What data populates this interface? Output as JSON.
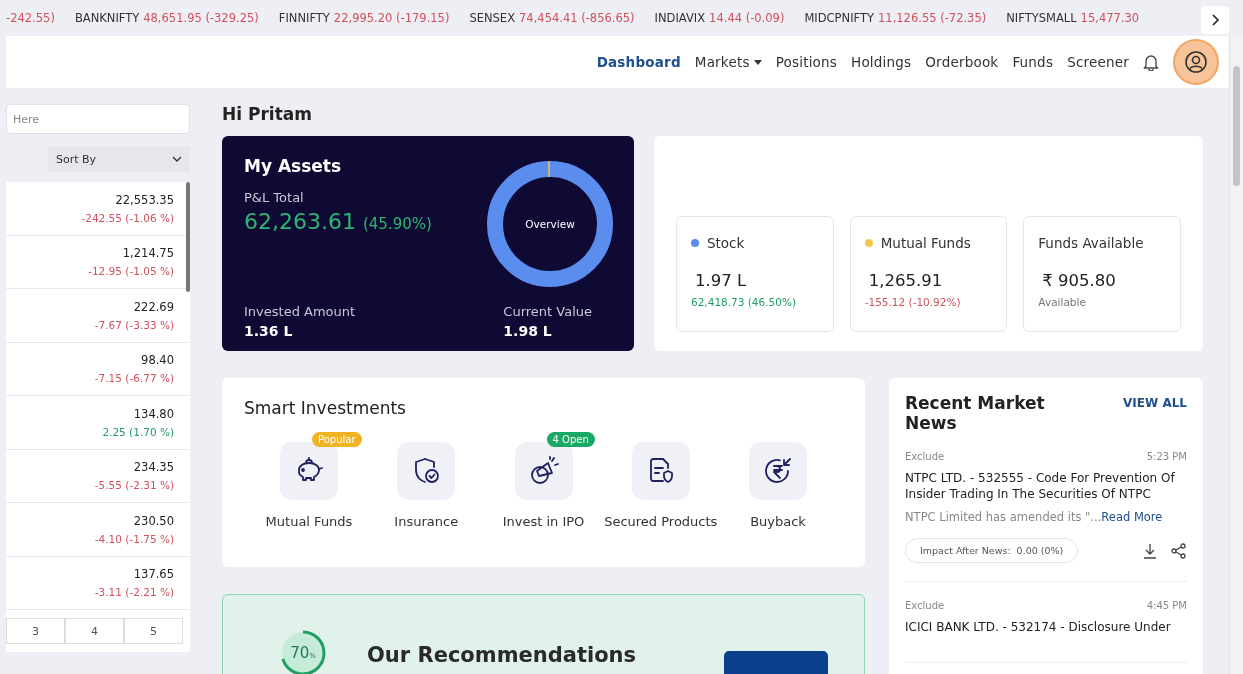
{
  "ticker": [
    {
      "change": "-242.55)",
      "kind": "loss"
    },
    {
      "name": "BANKNIFTY",
      "value": "48,651.95 (-329.25)",
      "kind": "loss"
    },
    {
      "name": "FINNIFTY",
      "value": "22,995.20 (-179.15)",
      "kind": "loss"
    },
    {
      "name": "SENSEX",
      "value": "74,454.41 (-856.65)",
      "kind": "loss"
    },
    {
      "name": "INDIAVIX",
      "value": "14.44 (-0.09)",
      "kind": "loss"
    },
    {
      "name": "MIDCPNIFTY",
      "value": "11,126.55 (-72.35)",
      "kind": "loss"
    },
    {
      "name": "NIFTYSMALL",
      "value": "15,477.30",
      "kind": "loss"
    }
  ],
  "nav": [
    {
      "label": "Dashboard",
      "selected": true,
      "kind": "link"
    },
    {
      "label": "Markets",
      "selected": false,
      "kind": "dropdown"
    },
    {
      "label": "Positions",
      "selected": false,
      "kind": "link"
    },
    {
      "label": "Holdings",
      "selected": false,
      "kind": "link"
    },
    {
      "label": "Orderbook",
      "selected": false,
      "kind": "link"
    },
    {
      "label": "Funds",
      "selected": false,
      "kind": "link"
    },
    {
      "label": "Screener",
      "selected": false,
      "kind": "link"
    }
  ],
  "sidebar": {
    "search": {
      "placeholder": "Here"
    },
    "sort": {
      "value": "Sort By"
    },
    "rows": [
      {
        "price": "22,553.35",
        "change": "-242.55 (-1.06 %)",
        "kind": "loss"
      },
      {
        "price": "1,214.75",
        "change": "-12.95 (-1.05 %)",
        "kind": "loss"
      },
      {
        "price": "222.69",
        "change": "-7.67 (-3.33 %)",
        "kind": "loss"
      },
      {
        "price": "98.40",
        "change": "-7.15 (-6.77 %)",
        "kind": "loss"
      },
      {
        "price": "134.80",
        "change": "2.25 (1.70 %)",
        "kind": "gain"
      },
      {
        "price": "234.35",
        "change": "-5.55 (-2.31 %)",
        "kind": "loss"
      },
      {
        "price": "230.50",
        "change": "-4.10 (-1.75 %)",
        "kind": "loss"
      },
      {
        "price": "137.65",
        "change": "-3.11 (-2.21 %)",
        "kind": "loss"
      }
    ],
    "pages": [
      {
        "label": "3",
        "selected": false
      },
      {
        "label": "4",
        "selected": false
      },
      {
        "label": "5",
        "selected": false
      }
    ]
  },
  "greeting": "Hi Pritam",
  "assets": {
    "title": "My Assets",
    "pnl_label": "P&L Total",
    "pnl_value": "62,263.61",
    "pnl_percent": "(45.90%)",
    "donut_label": "Overview",
    "invested_label": "Invested Amount",
    "invested_value": "1.36 L",
    "current_label": "Current Value",
    "current_value": "1.98 L"
  },
  "holdings": [
    {
      "label": "Stock",
      "color": "#5b8def",
      "value": "1.97 L",
      "sub": "62,418.73 (46.50%)",
      "kind": "gain"
    },
    {
      "label": "Mutual Funds",
      "color": "#f2c94c",
      "value": "1,265.91",
      "sub": "-155.12 (-10.92%)",
      "kind": "loss"
    },
    {
      "label": "Funds Available",
      "value": "₹ 905.80",
      "sub": "Available",
      "kind": "plain"
    }
  ],
  "smart_investments": {
    "title": "Smart Investments",
    "items": [
      {
        "label": "Mutual Funds",
        "kind": "piggy",
        "badge": "Popular",
        "color": "#f0b323"
      },
      {
        "label": "Insurance",
        "kind": "shield"
      },
      {
        "label": "Invest in IPO",
        "kind": "megaphone",
        "badge": "4 Open",
        "color": "#1aa865"
      },
      {
        "label": "Secured Products",
        "kind": "document"
      },
      {
        "label": "Buyback",
        "kind": "rupee"
      }
    ]
  },
  "recommendations": {
    "percent": "70",
    "unit": "%",
    "level": 0.7,
    "title": "Our Recommendations"
  },
  "news": {
    "title": "Recent Market News",
    "view_all": "VIEW ALL",
    "items": [
      {
        "tag": "Exclude",
        "time": "5:23 PM",
        "headline": "NTPC LTD. - 532555 - Code For Prevention Of Insider Trading In The Securities Of NTPC",
        "summary": "NTPC Limited has amended its \"...",
        "read_more": "Read More",
        "impact_label": "Impact After News:",
        "impact_value": "0.00 (0%)"
      },
      {
        "tag": "Exclude",
        "time": "4:45 PM",
        "headline": "ICICI BANK LTD. - 532174 - Disclosure Under"
      }
    ]
  }
}
